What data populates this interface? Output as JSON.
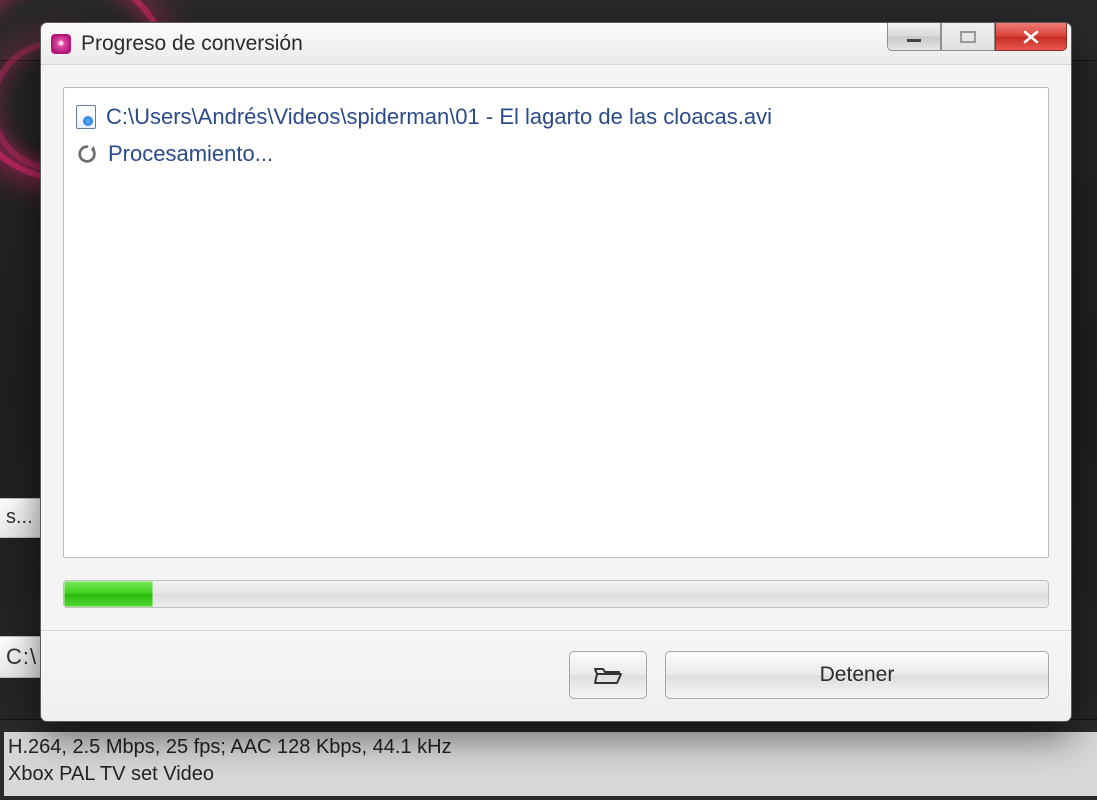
{
  "background": {
    "tab_label": "s...",
    "path_label": "C:\\",
    "codec_line1": "H.264, 2.5 Mbps, 25 fps; AAC 128 Kbps, 44.1 kHz",
    "codec_line2": "Xbox PAL TV set Video"
  },
  "dialog": {
    "title": "Progreso de conversión",
    "file_path": "C:\\Users\\Andrés\\Videos\\spiderman\\01 - El lagarto de las cloacas.avi",
    "status_text": "Procesamiento...",
    "progress_percent": 9,
    "buttons": {
      "stop_label": "Detener"
    }
  }
}
